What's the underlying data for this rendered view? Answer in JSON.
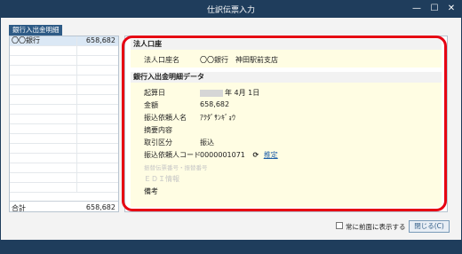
{
  "window": {
    "title": "仕訳伝票入力",
    "minimize_glyph": "—",
    "maximize_glyph": "☐",
    "close_glyph": "✕"
  },
  "sidebar": {
    "tab_label": "銀行入出金明細",
    "rows": [
      {
        "bank": "〇〇銀行",
        "amount": "658,682"
      }
    ],
    "total_label": "合計",
    "total_amount": "658,682"
  },
  "main": {
    "section1": {
      "title": "法人口座",
      "fields": [
        {
          "label": "法人口座名",
          "value": "〇〇銀行　神田駅前支店"
        }
      ]
    },
    "section2": {
      "title": "銀行入出金明細データ",
      "date_label": "起算日",
      "date_value": "年  4月  1日",
      "amount_label": "金額",
      "amount_value": "658,682",
      "requester_label": "振込依頼人名",
      "requester_value": "ｱｸﾀﾞｻﾝｷﾞｮｳ",
      "summary_label": "摘要内容",
      "summary_value": "",
      "type_label": "取引区分",
      "type_value": "振込",
      "code_label": "振込依頼人コード",
      "code_value": "0000001071",
      "code_icon": "refresh-icon",
      "code_link": "推定",
      "dim1_label": "振替伝票番号・振替番号",
      "dim2_label": "ＥＤＩ情報",
      "memo_label": "備考"
    }
  },
  "footer": {
    "checkbox_label": "常に前面に表示する",
    "close_button": "閉じる(C)"
  },
  "colors": {
    "titlebar": "#1f3d5c",
    "highlight_border": "#e60012",
    "section_bg": "#fffde3"
  }
}
